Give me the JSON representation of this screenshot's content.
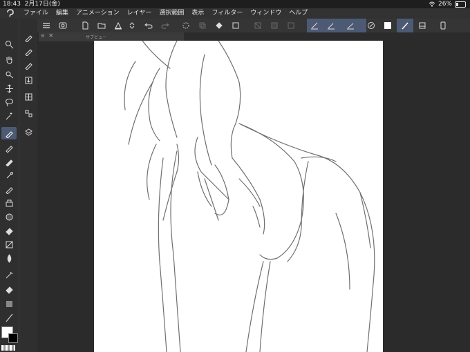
{
  "status": {
    "time": "18:43",
    "date": "2月17日(金)",
    "battery": "26%",
    "battery_level": 0.26
  },
  "menu": [
    "ファイル",
    "編集",
    "アニメーション",
    "レイヤー",
    "選択範囲",
    "表示",
    "フィルター",
    "ウィンドウ",
    "ヘルプ"
  ],
  "subview": {
    "close": "×",
    "title": "サブビュー"
  },
  "colors": {
    "accent": "#4d5a74",
    "canvas": "#ffffff",
    "main_color": "#ffffff",
    "sub_color": "#000000"
  }
}
